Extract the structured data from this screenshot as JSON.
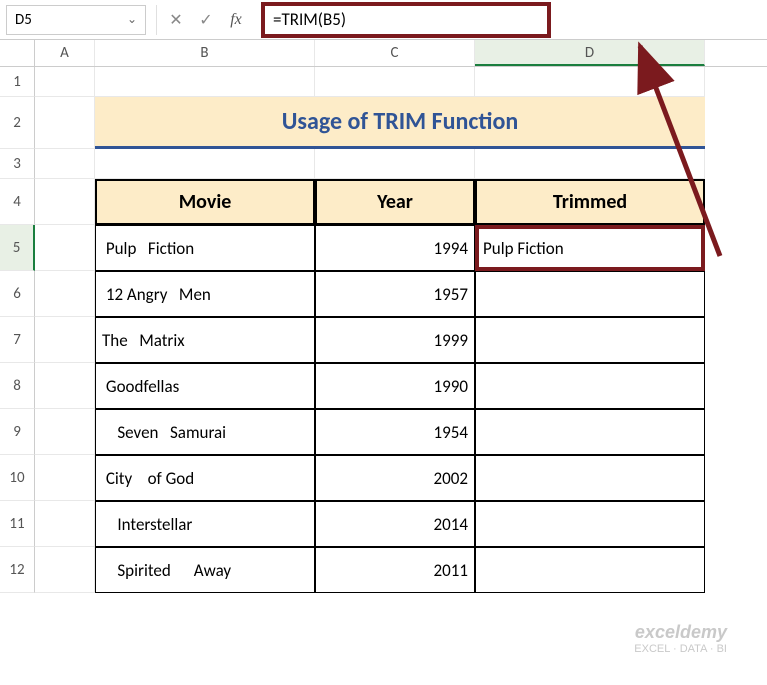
{
  "nameBox": "D5",
  "formula": "=TRIM(B5)",
  "columns": [
    "A",
    "B",
    "C",
    "D"
  ],
  "rowNumbers": [
    "1",
    "2",
    "3",
    "4",
    "5",
    "6",
    "7",
    "8",
    "9",
    "10",
    "11",
    "12"
  ],
  "title": "Usage of TRIM Function",
  "headers": {
    "movie": "Movie",
    "year": "Year",
    "trimmed": "Trimmed"
  },
  "rows": [
    {
      "movie": " Pulp   Fiction",
      "year": "1994",
      "trimmed": "Pulp Fiction"
    },
    {
      "movie": " 12 Angry   Men",
      "year": "1957",
      "trimmed": ""
    },
    {
      "movie": "The   Matrix",
      "year": "1999",
      "trimmed": ""
    },
    {
      "movie": " Goodfellas",
      "year": "1990",
      "trimmed": ""
    },
    {
      "movie": "    Seven   Samurai",
      "year": "1954",
      "trimmed": ""
    },
    {
      "movie": " City    of God",
      "year": "2002",
      "trimmed": ""
    },
    {
      "movie": "    Interstellar",
      "year": "2014",
      "trimmed": ""
    },
    {
      "movie": "    Spirited      Away",
      "year": "2011",
      "trimmed": ""
    }
  ],
  "watermark": {
    "brand": "exceldemy",
    "tag": "EXCEL · DATA · BI"
  }
}
